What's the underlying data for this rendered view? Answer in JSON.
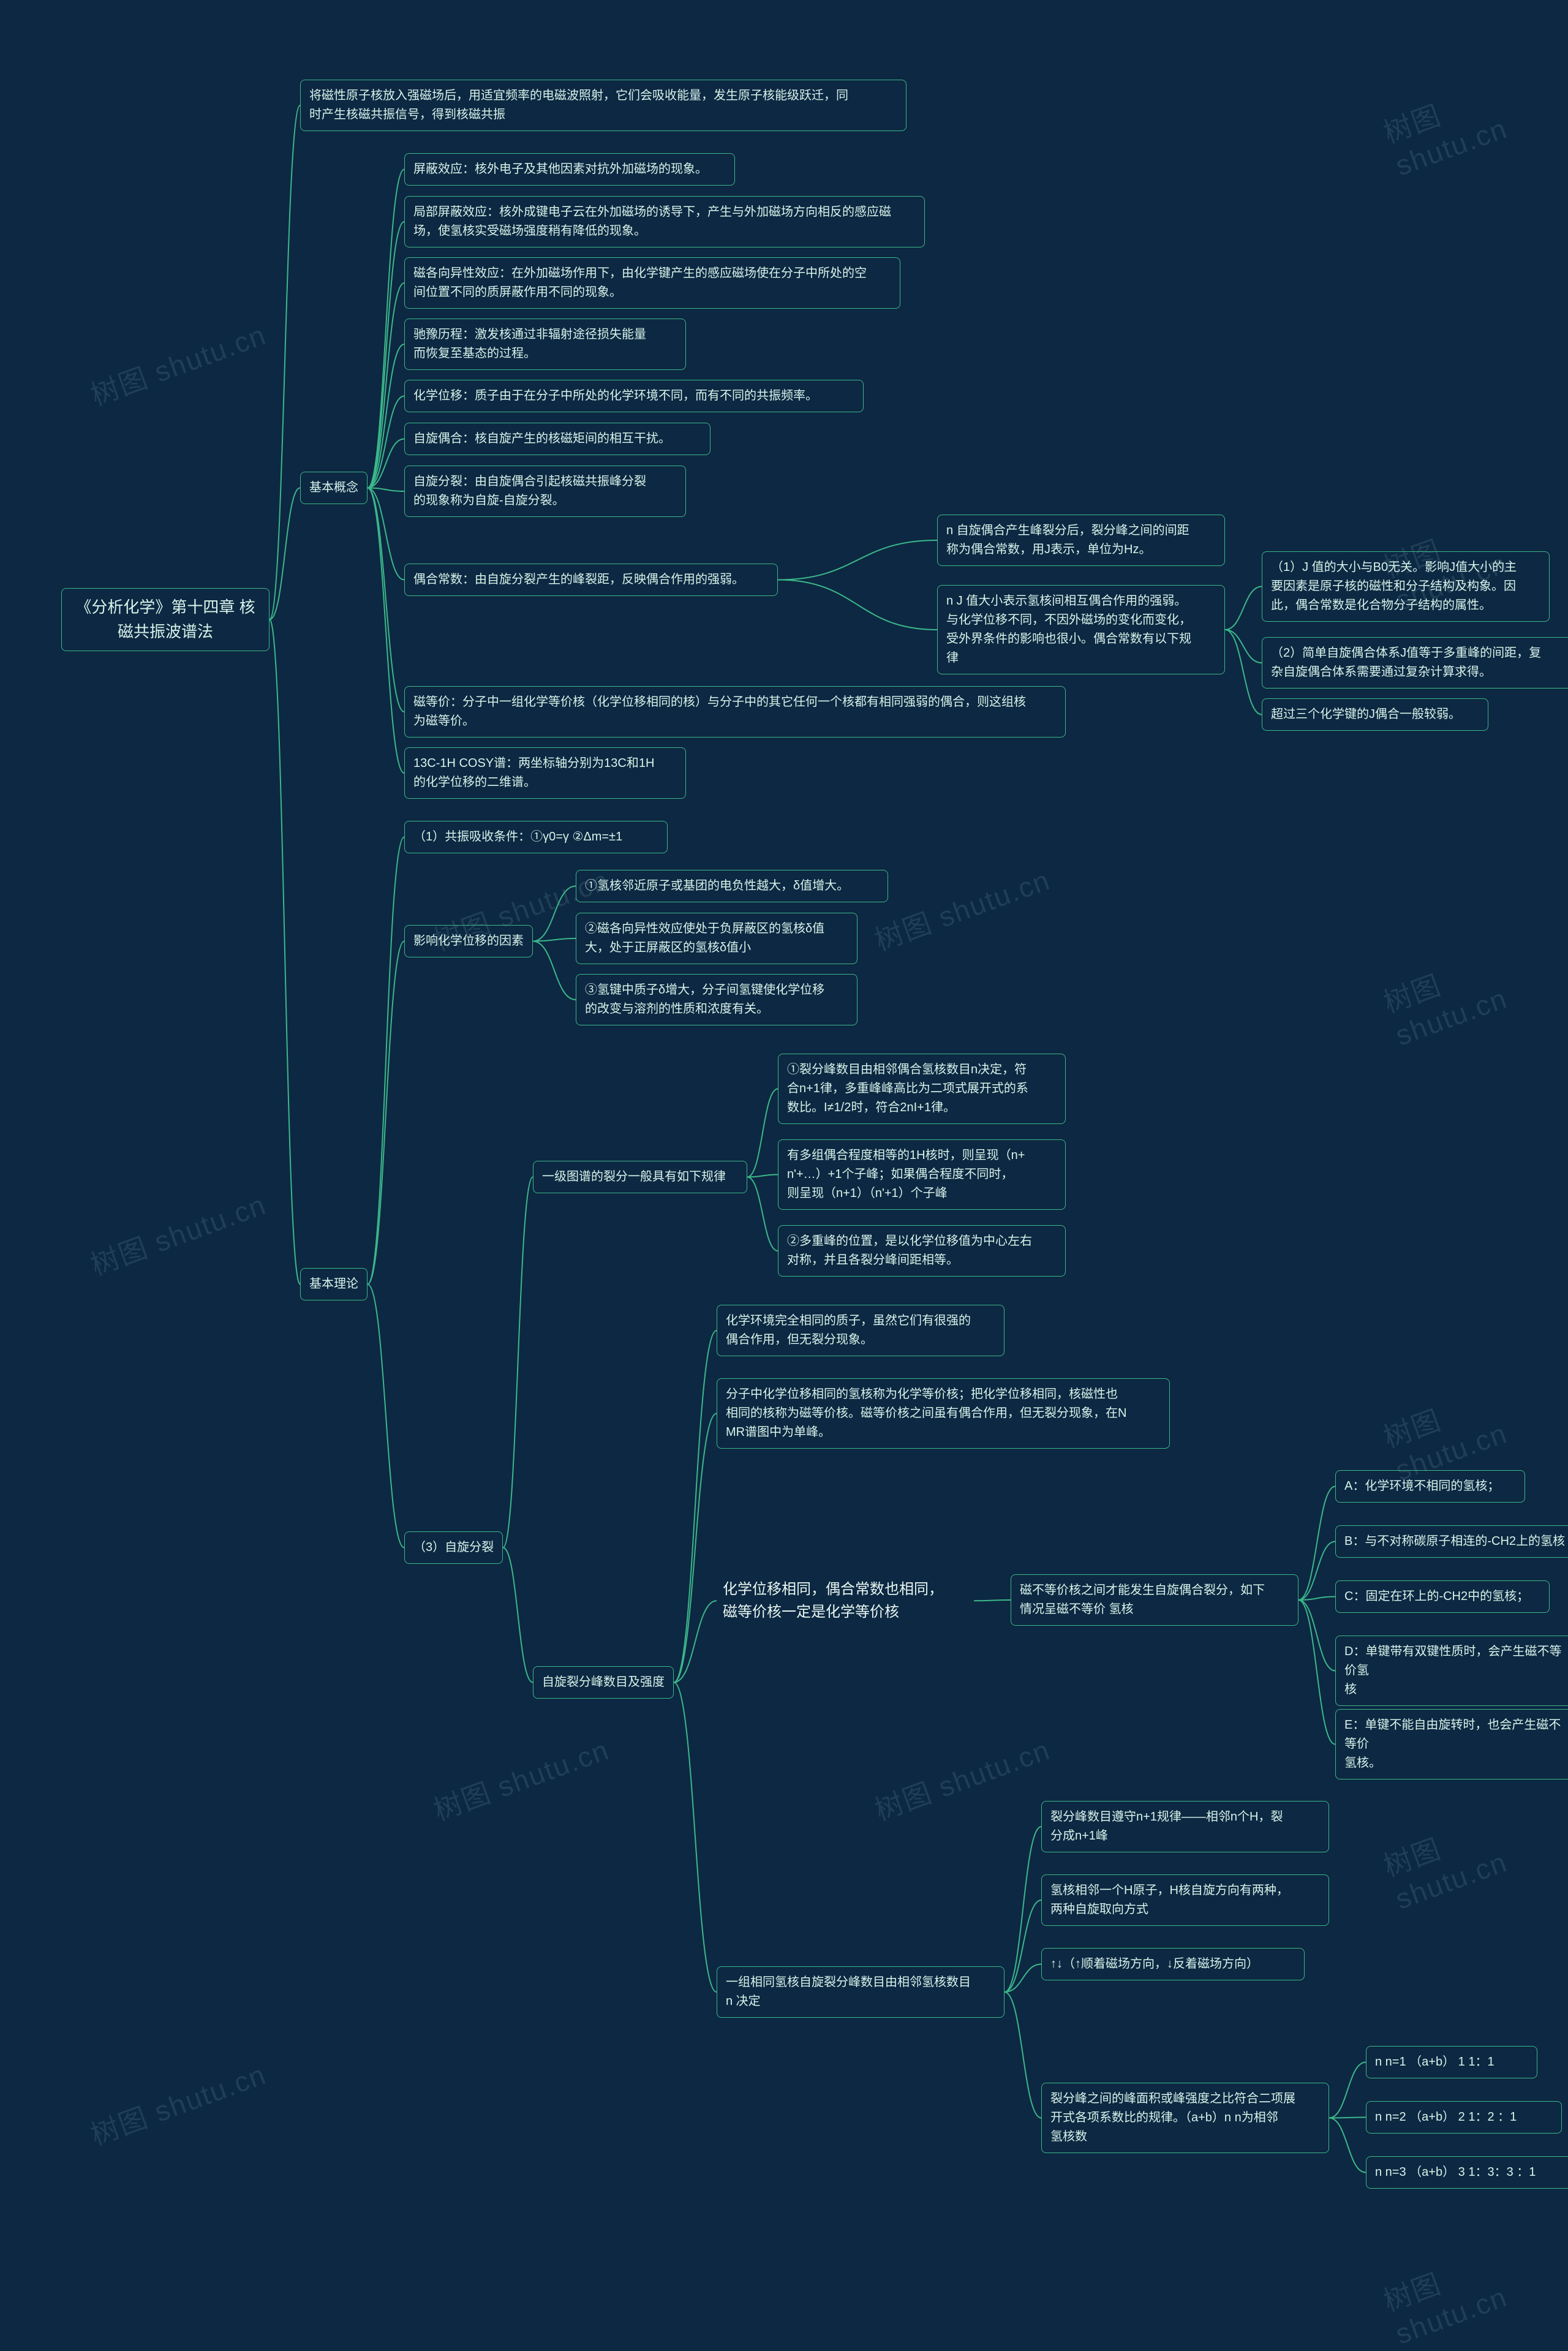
{
  "chart_data": {
    "type": "mindmap",
    "root": {
      "text": "《分析化学》第十四章 核磁共振波谱法",
      "children": [
        {
          "text": "将磁性原子核放入强磁场后，用适宜频率的电磁波照射，它们会吸收能量，发生原子核能级跃迁，同时产生核磁共振信号，得到核磁共振"
        },
        {
          "text": "基本概念",
          "children": [
            {
              "text": "屏蔽效应：核外电子及其他因素对抗外加磁场的现象。"
            },
            {
              "text": "局部屏蔽效应：核外成键电子云在外加磁场的诱导下，产生与外加磁场方向相反的感应磁场，使氢核实受磁场强度稍有降低的现象。"
            },
            {
              "text": "磁各向异性效应：在外加磁场作用下，由化学键产生的感应磁场使在分子中所处的空间位置不同的质屏蔽作用不同的现象。"
            },
            {
              "text": "驰豫历程：激发核通过非辐射途径损失能量而恢复至基态的过程。"
            },
            {
              "text": "化学位移：质子由于在分子中所处的化学环境不同，而有不同的共振频率。"
            },
            {
              "text": "自旋偶合：核自旋产生的核磁矩间的相互干扰。"
            },
            {
              "text": "自旋分裂：由自旋偶合引起核磁共振峰分裂的现象称为自旋-自旋分裂。"
            },
            {
              "text": "偶合常数：由自旋分裂产生的峰裂距，反映偶合作用的强弱。",
              "children": [
                {
                  "text": "n 自旋偶合产生峰裂分后，裂分峰之间的间距称为偶合常数，用J表示，单位为Hz。"
                },
                {
                  "text": "n J 值大小表示氢核间相互偶合作用的强弱。与化学位移不同，不因外磁场的变化而变化，受外界条件的影响也很小。偶合常数有以下规律",
                  "children": [
                    {
                      "text": "（1）J 值的大小与B0无关。影响J值大小的主要因素是原子核的磁性和分子结构及构象。因此，偶合常数是化合物分子结构的属性。"
                    },
                    {
                      "text": "（2）简单自旋偶合体系J值等于多重峰的间距，复杂自旋偶合体系需要通过复杂计算求得。"
                    },
                    {
                      "text": "超过三个化学键的J偶合一般较弱。"
                    }
                  ]
                }
              ]
            },
            {
              "text": "磁等价：分子中一组化学等价核（化学位移相同的核）与分子中的其它任何一个核都有相同强弱的偶合，则这组核为磁等价。"
            },
            {
              "text": "13C-1H COSY谱：两坐标轴分别为13C和1H的化学位移的二维谱。"
            }
          ]
        },
        {
          "text": "基本理论",
          "children": [
            {
              "text": "（1）共振吸收条件：①γ0=γ ②Δm=±1"
            },
            {
              "text": "影响化学位移的因素",
              "children": [
                {
                  "text": "①氢核邻近原子或基团的电负性越大，δ值增大。"
                },
                {
                  "text": "②磁各向异性效应使处于负屏蔽区的氢核δ值大，处于正屏蔽区的氢核δ值小"
                },
                {
                  "text": "③氢键中质子δ增大，分子间氢键使化学位移的改变与溶剂的性质和浓度有关。"
                }
              ]
            },
            {
              "text": "（3）自旋分裂",
              "children": [
                {
                  "text": "一级图谱的裂分一般具有如下规律",
                  "children": [
                    {
                      "text": "①裂分峰数目由相邻偶合氢核数目n决定，符合n+1律，多重峰峰高比为二项式展开式的系数比。I≠1/2时，符合2nI+1律。"
                    },
                    {
                      "text": "有多组偶合程度相等的1H核时，则呈现（n+n'+…）+1个子峰；如果偶合程度不同时，则呈现（n+1）（n'+1）个子峰"
                    },
                    {
                      "text": "②多重峰的位置，是以化学位移值为中心左右对称，并且各裂分峰间距相等。"
                    }
                  ]
                },
                {
                  "text": "自旋裂分峰数目及强度",
                  "children": [
                    {
                      "text": "化学环境完全相同的质子，虽然它们有很强的偶合作用，但无裂分现象。"
                    },
                    {
                      "text": "分子中化学位移相同的氢核称为化学等价核；把化学位移相同，核磁性也相同的核称为磁等价核。磁等价核之间虽有偶合作用，但无裂分现象，在NMR谱图中为单峰。"
                    },
                    {
                      "text": "化学位移相同，偶合常数也相同，磁等价核一定是化学等价核",
                      "children": [
                        {
                          "text": "磁不等价核之间才能发生自旋偶合裂分，如下情况呈磁不等价 氢核",
                          "children": [
                            {
                              "text": "A：化学环境不相同的氢核；"
                            },
                            {
                              "text": "B：与不对称碳原子相连的-CH2上的氢核"
                            },
                            {
                              "text": "C：固定在环上的-CH2中的氢核；"
                            },
                            {
                              "text": "D：单键带有双键性质时，会产生磁不等价氢核"
                            },
                            {
                              "text": "E：单键不能自由旋转时，也会产生磁不等价氢核。"
                            }
                          ]
                        }
                      ]
                    },
                    {
                      "text": "一组相同氢核自旋裂分峰数目由相邻氢核数目n 决定",
                      "children": [
                        {
                          "text": "裂分峰数目遵守n+1规律——相邻n个H，裂分成n+1峰"
                        },
                        {
                          "text": "氢核相邻一个H原子，H核自旋方向有两种，两种自旋取向方式"
                        },
                        {
                          "text": "↑↓（↑顺着磁场方向，↓反着磁场方向）"
                        },
                        {
                          "text": "裂分峰之间的峰面积或峰强度之比符合二项展开式各项系数比的规律。（a+b）n n为相邻氢核数",
                          "children": [
                            {
                              "text": "n n=1 （a+b） 1 1：1"
                            },
                            {
                              "text": "n n=2 （a+b） 2 1：2 ：1"
                            },
                            {
                              "text": "n n=3 （a+b） 3 1：3：3 ：1"
                            }
                          ]
                        }
                      ]
                    }
                  ]
                }
              ]
            }
          ]
        }
      ]
    }
  },
  "watermark_text": "树图 shutu.cn",
  "n_root": "《分析化学》第十四章 核\n磁共振波谱法",
  "n_intro": "将磁性原子核放入强磁场后，用适宜频率的电磁波照射，它们会吸收能量，发生原子核能级跃迁，同\n时产生核磁共振信号，得到核磁共振",
  "n_basic_concepts": "基本概念",
  "n_bc1": "屏蔽效应：核外电子及其他因素对抗外加磁场的现象。",
  "n_bc2": "局部屏蔽效应：核外成键电子云在外加磁场的诱导下，产生与外加磁场方向相反的感应磁\n场，使氢核实受磁场强度稍有降低的现象。",
  "n_bc3": "磁各向异性效应：在外加磁场作用下，由化学键产生的感应磁场使在分子中所处的空\n间位置不同的质屏蔽作用不同的现象。",
  "n_bc4": "驰豫历程：激发核通过非辐射途径损失能量\n而恢复至基态的过程。",
  "n_bc5": "化学位移：质子由于在分子中所处的化学环境不同，而有不同的共振频率。",
  "n_bc6": "自旋偶合：核自旋产生的核磁矩间的相互干扰。",
  "n_bc7": "自旋分裂：由自旋偶合引起核磁共振峰分裂\n的现象称为自旋-自旋分裂。",
  "n_bc8": "偶合常数：由自旋分裂产生的峰裂距，反映偶合作用的强弱。",
  "n_bc8_a": "n 自旋偶合产生峰裂分后，裂分峰之间的间距\n称为偶合常数，用J表示，单位为Hz。",
  "n_bc8_b": "n J 值大小表示氢核间相互偶合作用的强弱。\n与化学位移不同，不因外磁场的变化而变化，\n受外界条件的影响也很小。偶合常数有以下规\n律",
  "n_bc8_b1": "（1）J 值的大小与B0无关。影响J值大小的主\n要因素是原子核的磁性和分子结构及构象。因\n此，偶合常数是化合物分子结构的属性。",
  "n_bc8_b2": "（2）简单自旋偶合体系J值等于多重峰的间距，复\n杂自旋偶合体系需要通过复杂计算求得。",
  "n_bc8_b3": "超过三个化学键的J偶合一般较弱。",
  "n_bc9": "磁等价：分子中一组化学等价核（化学位移相同的核）与分子中的其它任何一个核都有相同强弱的偶合，则这组核\n为磁等价。",
  "n_bc10": "13C-1H COSY谱：两坐标轴分别为13C和1H\n的化学位移的二维谱。",
  "n_basic_theory": "基本理论",
  "n_bt1": "（1）共振吸收条件：①γ0=γ ②Δm=±1",
  "n_bt2": "影响化学位移的因素",
  "n_bt2_a": "①氢核邻近原子或基团的电负性越大，δ值增大。",
  "n_bt2_b": "②磁各向异性效应使处于负屏蔽区的氢核δ值\n大，处于正屏蔽区的氢核δ值小",
  "n_bt2_c": "③氢键中质子δ增大，分子间氢键使化学位移\n的改变与溶剂的性质和浓度有关。",
  "n_bt3": "（3）自旋分裂",
  "n_bt3_a": "一级图谱的裂分一般具有如下规律",
  "n_bt3_a1": "①裂分峰数目由相邻偶合氢核数目n决定，符\n合n+1律，多重峰峰高比为二项式展开式的系\n数比。I≠1/2时，符合2nI+1律。",
  "n_bt3_a2": "有多组偶合程度相等的1H核时，则呈现（n+\nn'+…）+1个子峰；如果偶合程度不同时，\n则呈现（n+1）（n'+1）个子峰",
  "n_bt3_a3": "②多重峰的位置，是以化学位移值为中心左右\n对称，并且各裂分峰间距相等。",
  "n_bt3_b": "自旋裂分峰数目及强度",
  "n_bt3_b1": "化学环境完全相同的质子，虽然它们有很强的\n偶合作用，但无裂分现象。",
  "n_bt3_b2": "分子中化学位移相同的氢核称为化学等价核；把化学位移相同，核磁性也\n相同的核称为磁等价核。磁等价核之间虽有偶合作用，但无裂分现象，在N\nMR谱图中为单峰。",
  "n_bt3_b3": "化学位移相同，偶合常数也相同，\n磁等价核一定是化学等价核",
  "n_bt3_b3c": "磁不等价核之间才能发生自旋偶合裂分，如下\n情况呈磁不等价 氢核",
  "n_bt3_b3_a": "A：化学环境不相同的氢核；",
  "n_bt3_b3_b": "B：与不对称碳原子相连的-CH2上的氢核",
  "n_bt3_b3_c2": "C：固定在环上的-CH2中的氢核；",
  "n_bt3_b3_d": "D：单键带有双键性质时，会产生磁不等价氢\n核",
  "n_bt3_b3_e": "E：单键不能自由旋转时，也会产生磁不等价\n氢核。",
  "n_bt3_b4": "一组相同氢核自旋裂分峰数目由相邻氢核数目\nn 决定",
  "n_bt3_b4_a": "裂分峰数目遵守n+1规律——相邻n个H，裂\n分成n+1峰",
  "n_bt3_b4_b": " 氢核相邻一个H原子，H核自旋方向有两种，\n两种自旋取向方式",
  "n_bt3_b4_c": "↑↓（↑顺着磁场方向，↓反着磁场方向）",
  "n_bt3_b4_d": "裂分峰之间的峰面积或峰强度之比符合二项展\n开式各项系数比的规律。（a+b）n n为相邻\n氢核数",
  "n_bt3_b4_d1": "n n=1 （a+b） 1 1：1",
  "n_bt3_b4_d2": "n n=2 （a+b） 2 1：2 ：1",
  "n_bt3_b4_d3": "n n=3 （a+b） 3 1：3：3 ：1"
}
